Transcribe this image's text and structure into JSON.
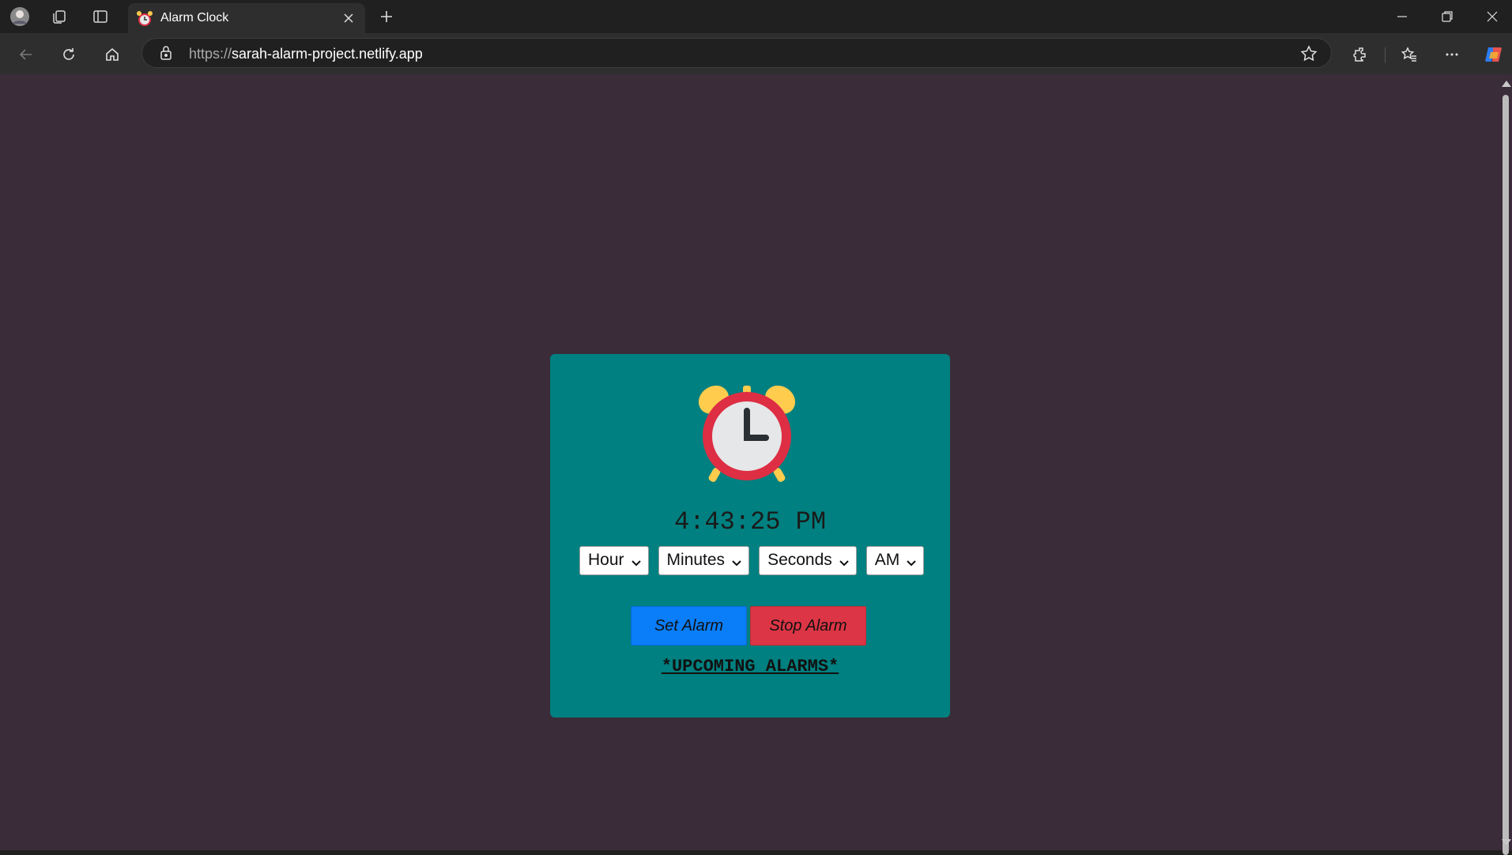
{
  "browser": {
    "tab": {
      "title": "Alarm Clock"
    },
    "address": {
      "scheme": "https://",
      "host": "sarah-alarm-project.netlify.app"
    }
  },
  "app": {
    "current_time": "4:43:25 PM",
    "selects": {
      "hour": "Hour",
      "minutes": "Minutes",
      "seconds": "Seconds",
      "ampm": "AM"
    },
    "buttons": {
      "set_alarm": "Set Alarm",
      "stop_alarm": "Stop Alarm"
    },
    "upcoming_heading": "*UPCOMING ALARMS*"
  },
  "colors": {
    "page_bg": "#3a2c38",
    "card_bg": "#008080",
    "set_button": "#0a7df8",
    "stop_button": "#dc3545"
  }
}
